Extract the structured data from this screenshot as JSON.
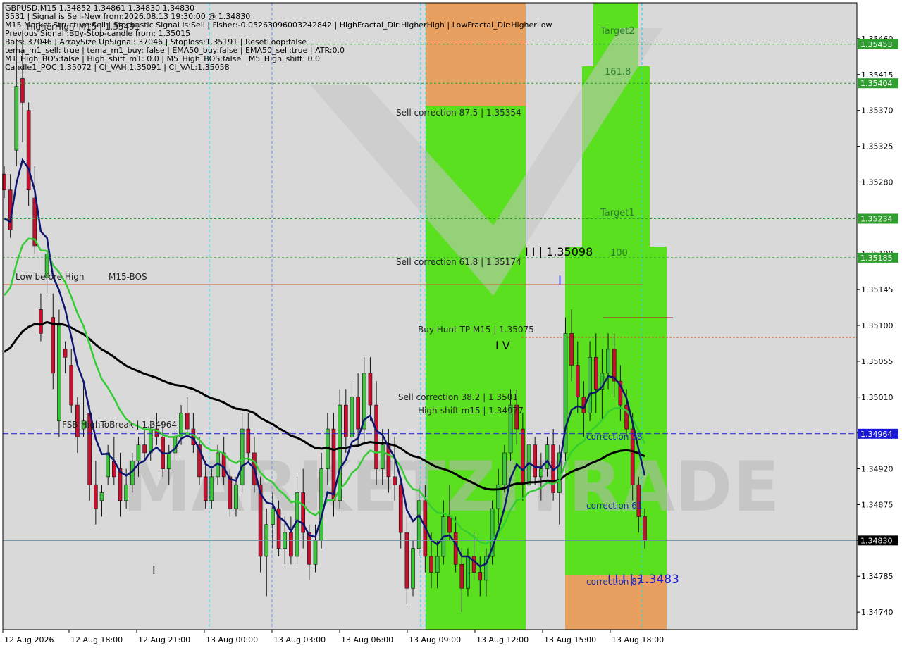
{
  "info_lines": [
    "GBPUSD,M15  1.34852 1.34861 1.34830 1.34830",
    "3531 | Signal is Sell-New from:2026.08.13 19:30:00 @ 1.34830",
    "M15 Market Structure:Sell | Stochastic Signal is:Sell | Fisher:-0.05263096003242842 | HighFractal_Dir:HigherHigh | LowFractal_Dir:HigherLow",
    "Previous Signal :Buy-Stop-candle from: 1.35015",
    "Bars: 37046 | ArraySize UpSignal: 37046 | Stoploss:1.35191 | ResetLoop:false",
    "tema_m1_sell: true | tema_m1_buy: false | EMA50_buy:false | EMA50_sell:true | ATR:0.0",
    "M1_High_BOS:false | High_shift_m1: 0.0 | M5_High_BOS:false | M5_High_shift: 0.0",
    "Candle1_POC:1.35072 | CI_VAH:1.35091 | CI_VAL:1.35058"
  ],
  "annotations": {
    "higher_high": "HigherHigh_M15 | 1.35491",
    "low_before_high": "Low before High",
    "m15_bos": "M15-BOS",
    "fsb": "FSB-HighToBreak | 1.34964",
    "sell_corr_875": "Sell correction 87.5 | 1.35354",
    "sell_corr_618": "Sell correction 61.8 | 1.35174",
    "sell_corr_382": "Sell correction 38.2 | 1.3501",
    "buy_hunt": "Buy Hunt TP M15 | 1.35075",
    "high_shift": "High-shift m15 | 1.34977",
    "iv": "I V",
    "ii": "I I | 1.35098",
    "i": "I",
    "iii": "I I I | 1.3483",
    "target2": "Target2",
    "target1": "Target1",
    "fib_1618": "161.8",
    "fib_100": "100",
    "corr_38": "correction 38",
    "corr_61": "correction 61",
    "corr_87": "correction 87",
    "bar_i": "I"
  },
  "watermark": "MARKETZITRADE",
  "colors": {
    "bull": "#3cc43c",
    "bear": "#c8102e",
    "ema_navy": "#0d1570",
    "ema_green": "#33cc33",
    "ma_black": "#000000",
    "zone_green": "#5ae01e",
    "zone_orange": "#e8a060",
    "line_blue": "#1a1ad6",
    "tag_green": "#2e9e2e"
  },
  "chart_data": {
    "type": "candlestick",
    "symbol": "GBPUSD",
    "timeframe": "M15",
    "ylim": [
      1.34718,
      1.35505
    ],
    "y_ticks": [
      1.3546,
      1.35415,
      1.3537,
      1.35325,
      1.3528,
      1.35235,
      1.3519,
      1.35145,
      1.351,
      1.35055,
      1.3501,
      1.34965,
      1.3492,
      1.34875,
      1.3483,
      1.34785,
      1.3474
    ],
    "x_labels": [
      "12 Aug 2026",
      "12 Aug 18:00",
      "12 Aug 21:00",
      "13 Aug 00:00",
      "13 Aug 03:00",
      "13 Aug 06:00",
      "13 Aug 09:00",
      "13 Aug 12:00",
      "13 Aug 15:00",
      "13 Aug 18:00"
    ],
    "price_tags": [
      {
        "label": "1.35453",
        "value": 1.35453,
        "color": "#2e9e2e"
      },
      {
        "label": "1.35404",
        "value": 1.35404,
        "color": "#2e9e2e"
      },
      {
        "label": "1.35234",
        "value": 1.35234,
        "color": "#2e9e2e"
      },
      {
        "label": "1.35185",
        "value": 1.35185,
        "color": "#2e9e2e"
      },
      {
        "label": "1.34964",
        "value": 1.34964,
        "color": "#1a1ad6"
      },
      {
        "label": "1.34830",
        "value": 1.3483,
        "color": "#000000"
      }
    ],
    "candles": [
      [
        1.3529,
        1.353,
        1.3526,
        1.3527
      ],
      [
        1.3527,
        1.3529,
        1.3521,
        1.3522
      ],
      [
        1.3532,
        1.3546,
        1.353,
        1.354
      ],
      [
        1.3541,
        1.3547,
        1.3533,
        1.3538
      ],
      [
        1.3537,
        1.3538,
        1.3525,
        1.3527
      ],
      [
        1.3526,
        1.353,
        1.3519,
        1.352
      ],
      [
        1.3512,
        1.3514,
        1.3508,
        1.3509
      ],
      [
        1.3516,
        1.3521,
        1.3514,
        1.3519
      ],
      [
        1.3511,
        1.3514,
        1.3502,
        1.3504
      ],
      [
        1.3498,
        1.3512,
        1.3496,
        1.351
      ],
      [
        1.3507,
        1.3508,
        1.3504,
        1.3506
      ],
      [
        1.3505,
        1.3507,
        1.3499,
        1.35
      ],
      [
        1.35,
        1.3501,
        1.3494,
        1.3496
      ],
      [
        1.3497,
        1.3503,
        1.3496,
        1.3498
      ],
      [
        1.3499,
        1.35,
        1.3488,
        1.349
      ],
      [
        1.349,
        1.3493,
        1.3485,
        1.3487
      ],
      [
        1.3488,
        1.349,
        1.3486,
        1.3489
      ],
      [
        1.3491,
        1.3495,
        1.349,
        1.3494
      ],
      [
        1.3493,
        1.3496,
        1.349,
        1.3491
      ],
      [
        1.3492,
        1.3494,
        1.3486,
        1.3488
      ],
      [
        1.3488,
        1.3492,
        1.3487,
        1.349
      ],
      [
        1.349,
        1.3494,
        1.3489,
        1.3493
      ],
      [
        1.3493,
        1.3496,
        1.3491,
        1.3495
      ],
      [
        1.3495,
        1.3497,
        1.3493,
        1.3494
      ],
      [
        1.3494,
        1.3498,
        1.3493,
        1.3497
      ],
      [
        1.3497,
        1.3499,
        1.3495,
        1.3496
      ],
      [
        1.3496,
        1.3498,
        1.3491,
        1.3492
      ],
      [
        1.3492,
        1.3495,
        1.349,
        1.3494
      ],
      [
        1.3494,
        1.3497,
        1.3493,
        1.3496
      ],
      [
        1.3496,
        1.35,
        1.3495,
        1.3499
      ],
      [
        1.3499,
        1.3501,
        1.3496,
        1.3497
      ],
      [
        1.3497,
        1.3499,
        1.3494,
        1.3495
      ],
      [
        1.3495,
        1.3496,
        1.349,
        1.3491
      ],
      [
        1.3491,
        1.3493,
        1.3487,
        1.3488
      ],
      [
        1.3488,
        1.3492,
        1.3487,
        1.3491
      ],
      [
        1.3491,
        1.3495,
        1.349,
        1.3494
      ],
      [
        1.3494,
        1.3496,
        1.349,
        1.3491
      ],
      [
        1.3491,
        1.3492,
        1.3486,
        1.3487
      ],
      [
        1.3487,
        1.3491,
        1.3486,
        1.349
      ],
      [
        1.349,
        1.3499,
        1.3489,
        1.3497
      ],
      [
        1.3497,
        1.3499,
        1.3493,
        1.3494
      ],
      [
        1.3494,
        1.3496,
        1.3489,
        1.349
      ],
      [
        1.349,
        1.3491,
        1.3479,
        1.3481
      ],
      [
        1.3481,
        1.3487,
        1.3476,
        1.3485
      ],
      [
        1.3485,
        1.3489,
        1.3482,
        1.3487
      ],
      [
        1.3487,
        1.3488,
        1.3481,
        1.3482
      ],
      [
        1.3482,
        1.3486,
        1.348,
        1.3484
      ],
      [
        1.3484,
        1.3486,
        1.348,
        1.3481
      ],
      [
        1.3481,
        1.3491,
        1.348,
        1.3489
      ],
      [
        1.3489,
        1.3492,
        1.3482,
        1.3484
      ],
      [
        1.3484,
        1.3485,
        1.3478,
        1.348
      ],
      [
        1.348,
        1.3485,
        1.3479,
        1.3483
      ],
      [
        1.3483,
        1.3494,
        1.3482,
        1.3492
      ],
      [
        1.3492,
        1.3499,
        1.349,
        1.3497
      ],
      [
        1.3497,
        1.3499,
        1.3486,
        1.3488
      ],
      [
        1.3488,
        1.3502,
        1.3487,
        1.35
      ],
      [
        1.35,
        1.3502,
        1.3494,
        1.3496
      ],
      [
        1.3496,
        1.3503,
        1.3495,
        1.3501
      ],
      [
        1.3501,
        1.3504,
        1.3495,
        1.3497
      ],
      [
        1.3497,
        1.3506,
        1.3495,
        1.3504
      ],
      [
        1.3504,
        1.3506,
        1.3498,
        1.35
      ],
      [
        1.35,
        1.3503,
        1.349,
        1.3492
      ],
      [
        1.3492,
        1.3497,
        1.349,
        1.3495
      ],
      [
        1.3495,
        1.3497,
        1.3489,
        1.3491
      ],
      [
        1.3491,
        1.3496,
        1.3488,
        1.349
      ],
      [
        1.349,
        1.3491,
        1.3482,
        1.3484
      ],
      [
        1.3484,
        1.3486,
        1.3475,
        1.3477
      ],
      [
        1.3477,
        1.3483,
        1.3476,
        1.3482
      ],
      [
        1.3482,
        1.349,
        1.3481,
        1.3488
      ],
      [
        1.3488,
        1.349,
        1.3479,
        1.3481
      ],
      [
        1.3481,
        1.3484,
        1.3477,
        1.3479
      ],
      [
        1.3479,
        1.3483,
        1.3477,
        1.3481
      ],
      [
        1.3481,
        1.3488,
        1.348,
        1.3486
      ],
      [
        1.3486,
        1.349,
        1.3483,
        1.3484
      ],
      [
        1.3484,
        1.3486,
        1.3479,
        1.348
      ],
      [
        1.348,
        1.3482,
        1.3474,
        1.3477
      ],
      [
        1.3477,
        1.3482,
        1.3476,
        1.3481
      ],
      [
        1.3481,
        1.3484,
        1.3478,
        1.3479
      ],
      [
        1.3479,
        1.3481,
        1.3476,
        1.3478
      ],
      [
        1.3478,
        1.3482,
        1.3476,
        1.3481
      ],
      [
        1.3481,
        1.3488,
        1.348,
        1.3487
      ],
      [
        1.3487,
        1.3492,
        1.3485,
        1.349
      ],
      [
        1.349,
        1.3495,
        1.3489,
        1.3494
      ],
      [
        1.3494,
        1.3502,
        1.3493,
        1.35
      ],
      [
        1.35,
        1.3502,
        1.3495,
        1.3497
      ],
      [
        1.3497,
        1.3499,
        1.3488,
        1.349
      ],
      [
        1.349,
        1.3496,
        1.3489,
        1.3495
      ],
      [
        1.3495,
        1.3496,
        1.349,
        1.3491
      ],
      [
        1.3491,
        1.3494,
        1.3488,
        1.3492
      ],
      [
        1.3492,
        1.3496,
        1.3491,
        1.3495
      ],
      [
        1.3495,
        1.3497,
        1.3488,
        1.3489
      ],
      [
        1.3489,
        1.3495,
        1.3485,
        1.3494
      ],
      [
        1.3494,
        1.3511,
        1.3493,
        1.3509
      ],
      [
        1.3509,
        1.3512,
        1.3503,
        1.3505
      ],
      [
        1.3505,
        1.3508,
        1.3499,
        1.3501
      ],
      [
        1.3501,
        1.3503,
        1.3496,
        1.3499
      ],
      [
        1.3499,
        1.3508,
        1.3498,
        1.3506
      ],
      [
        1.3506,
        1.3509,
        1.3499,
        1.3502
      ],
      [
        1.3502,
        1.3507,
        1.3498,
        1.3504
      ],
      [
        1.3504,
        1.3509,
        1.3502,
        1.3507
      ],
      [
        1.3507,
        1.3509,
        1.3501,
        1.3503
      ],
      [
        1.3503,
        1.3505,
        1.3498,
        1.35
      ],
      [
        1.35,
        1.3502,
        1.3496,
        1.3497
      ],
      [
        1.3497,
        1.3499,
        1.3488,
        1.349
      ],
      [
        1.349,
        1.3491,
        1.3484,
        1.3486
      ],
      [
        1.3486,
        1.3487,
        1.3482,
        1.3483
      ]
    ]
  }
}
